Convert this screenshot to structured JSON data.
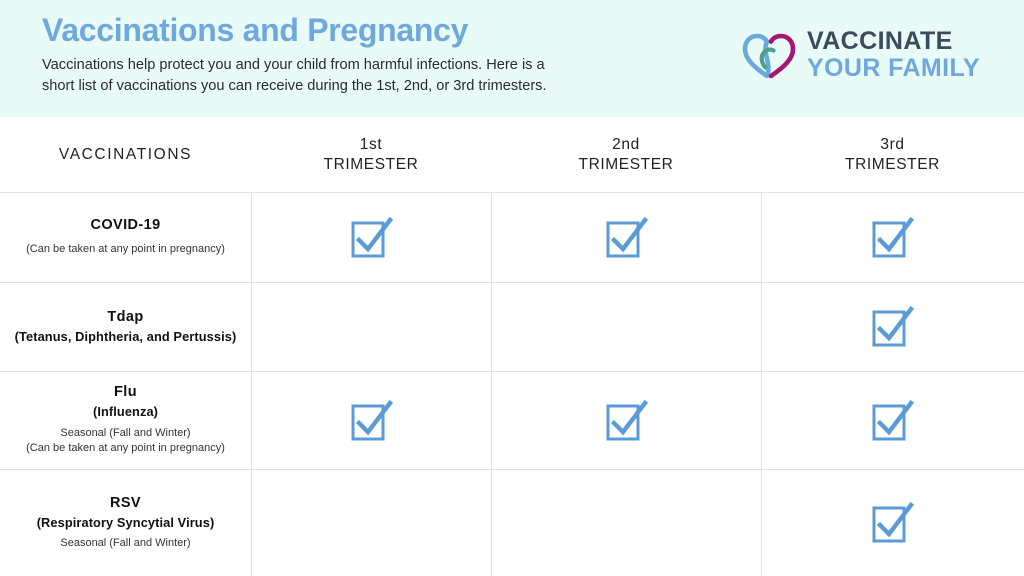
{
  "banner": {
    "title": "Vaccinations and Pregnancy",
    "subtitle_line1": "Vaccinations help protect you and your child from harmful infections. Here is a",
    "subtitle_line2": "short list of vaccinations you can receive during the 1st, 2nd, or 3rd trimesters.",
    "background_color": "#e8fbf7",
    "title_color": "#6fa8dc"
  },
  "logo": {
    "icon": "heart-icon",
    "line1": "VACCINATE",
    "line2": "YOUR FAMILY",
    "line1_color": "#3d4a5c",
    "line2_color": "#6fa8dc",
    "heart_blue": "#6aa9dd",
    "heart_magenta": "#a6186e",
    "heart_teal": "#4e9e8f"
  },
  "table": {
    "headers": {
      "vaccinations": "VACCINATIONS",
      "trimester1_line1": "1st",
      "trimester1_line2": "TRIMESTER",
      "trimester2_line1": "2nd",
      "trimester2_line2": "TRIMESTER",
      "trimester3_line1": "3rd",
      "trimester3_line2": "TRIMESTER"
    },
    "check_color": "#5b9bd5",
    "rows": [
      {
        "name": "COVID-19",
        "bold_sub": "",
        "note_line1": "(Can be taken at any point in pregnancy)",
        "note_line2": "",
        "trimester1": "checked",
        "trimester2": "checked",
        "trimester3": "checked"
      },
      {
        "name": "Tdap",
        "bold_sub": "(Tetanus, Diphtheria, and Pertussis)",
        "note_line1": "",
        "note_line2": "",
        "trimester1": "unchecked",
        "trimester2": "unchecked",
        "trimester3": "checked"
      },
      {
        "name": "Flu",
        "bold_sub": "(Influenza)",
        "note_line1": "Seasonal (Fall and Winter)",
        "note_line2": "(Can be taken at any point in pregnancy)",
        "trimester1": "checked",
        "trimester2": "checked",
        "trimester3": "checked"
      },
      {
        "name": "RSV",
        "bold_sub": "(Respiratory Syncytial Virus)",
        "note_line1": "Seasonal (Fall and Winter)",
        "note_line2": "",
        "trimester1": "unchecked",
        "trimester2": "unchecked",
        "trimester3": "checked"
      }
    ]
  }
}
